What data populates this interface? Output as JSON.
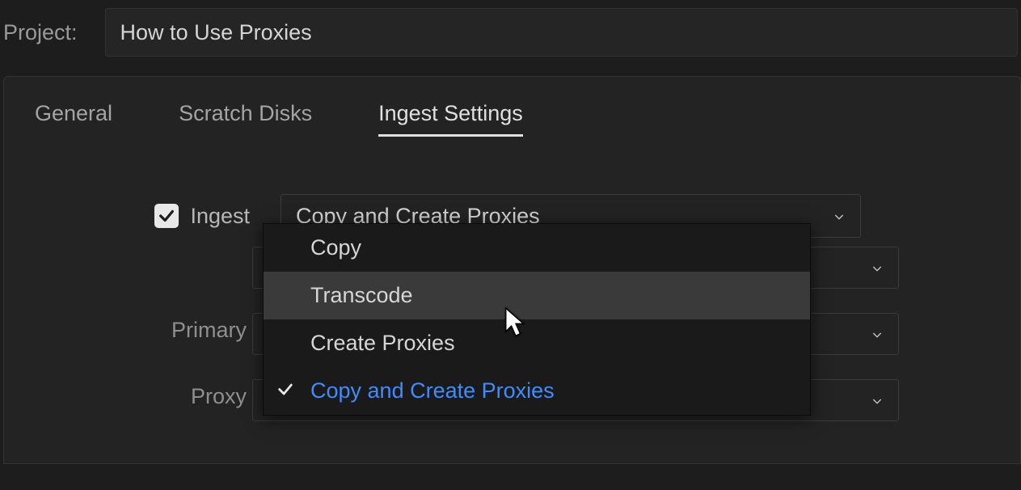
{
  "project": {
    "label": "Project:",
    "name": "How to Use Proxies"
  },
  "tabs": {
    "general": "General",
    "scratch_disks": "Scratch Disks",
    "ingest_settings": "Ingest Settings",
    "active": "ingest_settings"
  },
  "settings": {
    "ingest": {
      "checkbox_label": "Ingest",
      "checked": true,
      "selected": "Copy and Create Proxies"
    },
    "primary_label": "Primary",
    "proxy_label": "Proxy"
  },
  "ingest_dropdown": {
    "options": [
      {
        "label": "Copy",
        "selected": false,
        "hover": false
      },
      {
        "label": "Transcode",
        "selected": false,
        "hover": true
      },
      {
        "label": "Create Proxies",
        "selected": false,
        "hover": false
      },
      {
        "label": "Copy and Create Proxies",
        "selected": true,
        "hover": false
      }
    ]
  },
  "colors": {
    "bg": "#1d1d1d",
    "panel": "#232323",
    "text": "#b7b7b7",
    "accent": "#3f8cff",
    "hover": "#3a3a3a"
  }
}
